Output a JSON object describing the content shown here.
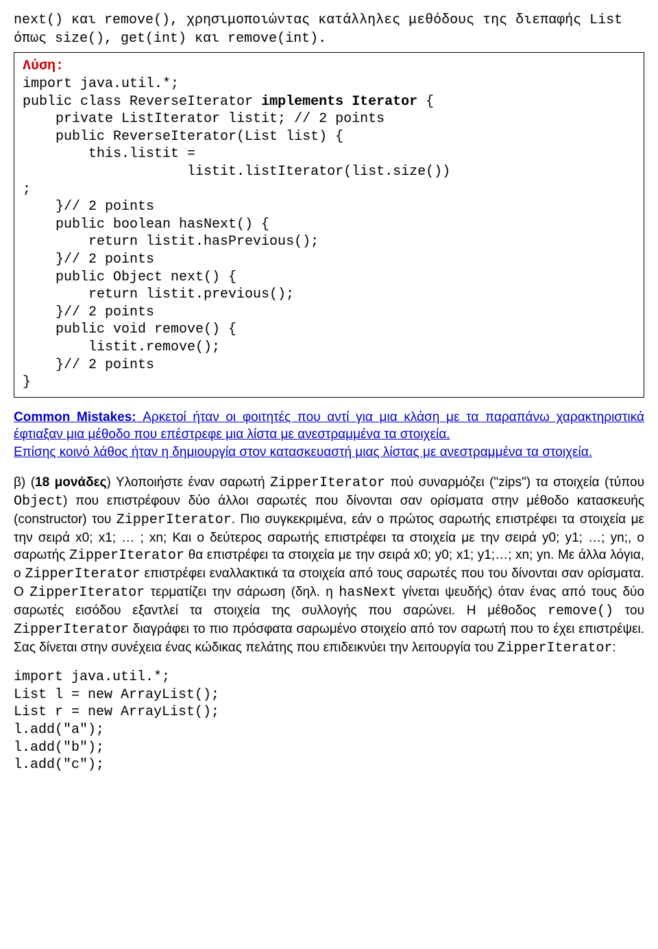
{
  "intro": {
    "full": "next() και remove(), χρησιμοποιώντας κατάλληλες μεθόδους της διεπαφής List όπως size(), get(int) και remove(int)."
  },
  "codebox": {
    "lysi": "Λύση:",
    "line_import": "import java.util.*;",
    "line_class_a": "public class ReverseIterator ",
    "line_class_b": "implements Iterator",
    "line_class_c": " {",
    "line_field": "    private ListIterator listit; // 2 points",
    "blank1": "",
    "line_ctor1": "    public ReverseIterator(List list) {",
    "line_ctor2": "        this.listit =",
    "line_ctor3": "                    listit.listIterator(list.size())",
    "line_ctor4": ";",
    "line_end1a": "    }// 2 points",
    "line_hasnext1": "    public boolean hasNext() {",
    "line_hasnext2": "        return listit.hasPrevious();",
    "line_end2": "    }// 2 points",
    "line_next1": "    public Object next() {",
    "line_next2": "        return listit.previous();",
    "line_end3": "    }// 2 points",
    "line_rem1": "    public void remove() {",
    "line_rem2": "        listit.remove();",
    "line_end4": "    }// 2 points",
    "line_close": "}"
  },
  "mistakes": {
    "label": "Common Mistakes:",
    "p1_rest": " Αρκετοί ήταν οι φοιτητές που αντί για μια κλάση με τα παραπάνω χαρακτηριστικά έφτιαξαν μια μέθοδο που επέστρεφε μια λίστα με ανεστραμμένα τα στοιχεία.",
    "p2": "Επίσης κοινό λάθος ήταν η δημιουργία στον κατασκευαστή μιας λίστας με ανεστραμμένα τα στοιχεία."
  },
  "paraB": {
    "lead": "β) (",
    "points": "18 μονάδες",
    "after_points": ") Υλοποιήστε έναν σαρωτή ",
    "m1": "ZipperIterator",
    "t1": " πού συναρμόζει (\"zips\") τα στοιχεία (τύπου ",
    "m2": "Object",
    "t2": ") που επιστρέφουν δύο άλλοι σαρωτές που δίνονται σαν ορίσματα στην μέθοδο κατασκευής (constructor) του ",
    "m3": "ZipperIterator",
    "t3": ". Πιο συγκεκριμένα, εάν ο πρώτος σαρωτής επιστρέφει τα στοιχεία με την σειρά x0; x1; … ; xn; Και ο δεύτερος σαρωτής επιστρέφει τα στοιχεία με την σειρά y0; y1; …; yn;, ο σαρωτής ",
    "m4": "ZipperIterator",
    "t4": " θα επιστρέφει τα στοιχεία με την σειρά x0; y0; x1; y1;…; xn; yn. Με άλλα λόγια, ο ",
    "m5": "ZipperIterator",
    "t5": " επιστρέφει εναλλακτικά τα στοιχεία από τους σαρωτές που του δίνονται σαν ορίσματα. Ο ",
    "m6": "ZipperIterator",
    "t6": " τερματίζει την σάρωση (δηλ. η ",
    "m7": "hasNext",
    "t7": " γίνεται ψευδής) όταν ένας από τους δύο σαρωτές εισόδου εξαντλεί τα στοιχεία της συλλογής που σαρώνει. Η μέθοδος ",
    "m8": "remove()",
    "t8": " του ",
    "m9": "ZipperIterator",
    "t9": " διαγράφει το πιο πρόσφατα σαρωμένο στοιχείο από τον σαρωτή που το έχει επιστρέψει. Σας δίνεται στην συνέχεια ένας κώδικας πελάτης που επιδεικνύει την λειτουργία του ",
    "m10": "ZipperIterator",
    "t10": ":"
  },
  "tailcode": {
    "l1": "import java.util.*;",
    "l2": "List l = new ArrayList();",
    "l3": "List r = new ArrayList();",
    "l4": "l.add(\"a\");",
    "l5": "l.add(\"b\");",
    "l6": "l.add(\"c\");"
  }
}
